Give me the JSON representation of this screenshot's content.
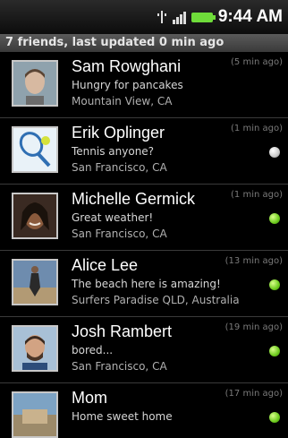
{
  "status_bar": {
    "time": "9:44 AM"
  },
  "header": {
    "summary": "7 friends, last updated 0 min ago"
  },
  "friends": [
    {
      "name": "Sam Rowghani",
      "status": "Hungry for pancakes",
      "location": "Mountain View, CA",
      "updated": "(5 min ago)",
      "presence": "none"
    },
    {
      "name": "Erik Oplinger",
      "status": "Tennis anyone?",
      "location": "San Francisco, CA",
      "updated": "(1 min ago)",
      "presence": "idle"
    },
    {
      "name": "Michelle Germick",
      "status": "Great weather!",
      "location": "San Francisco, CA",
      "updated": "(1 min ago)",
      "presence": "online"
    },
    {
      "name": "Alice Lee",
      "status": "The beach here is amazing!",
      "location": "Surfers Paradise QLD, Australia",
      "updated": "(13 min ago)",
      "presence": "online"
    },
    {
      "name": "Josh Rambert",
      "status": "bored...",
      "location": "San Francisco, CA",
      "updated": "(19 min ago)",
      "presence": "online"
    },
    {
      "name": "Mom",
      "status": "Home sweet home",
      "location": "",
      "updated": "(17 min ago)",
      "presence": "online"
    }
  ],
  "colors": {
    "online": "#6dcb1e",
    "idle": "#c9c9c9",
    "battery": "#6fdc3a"
  }
}
